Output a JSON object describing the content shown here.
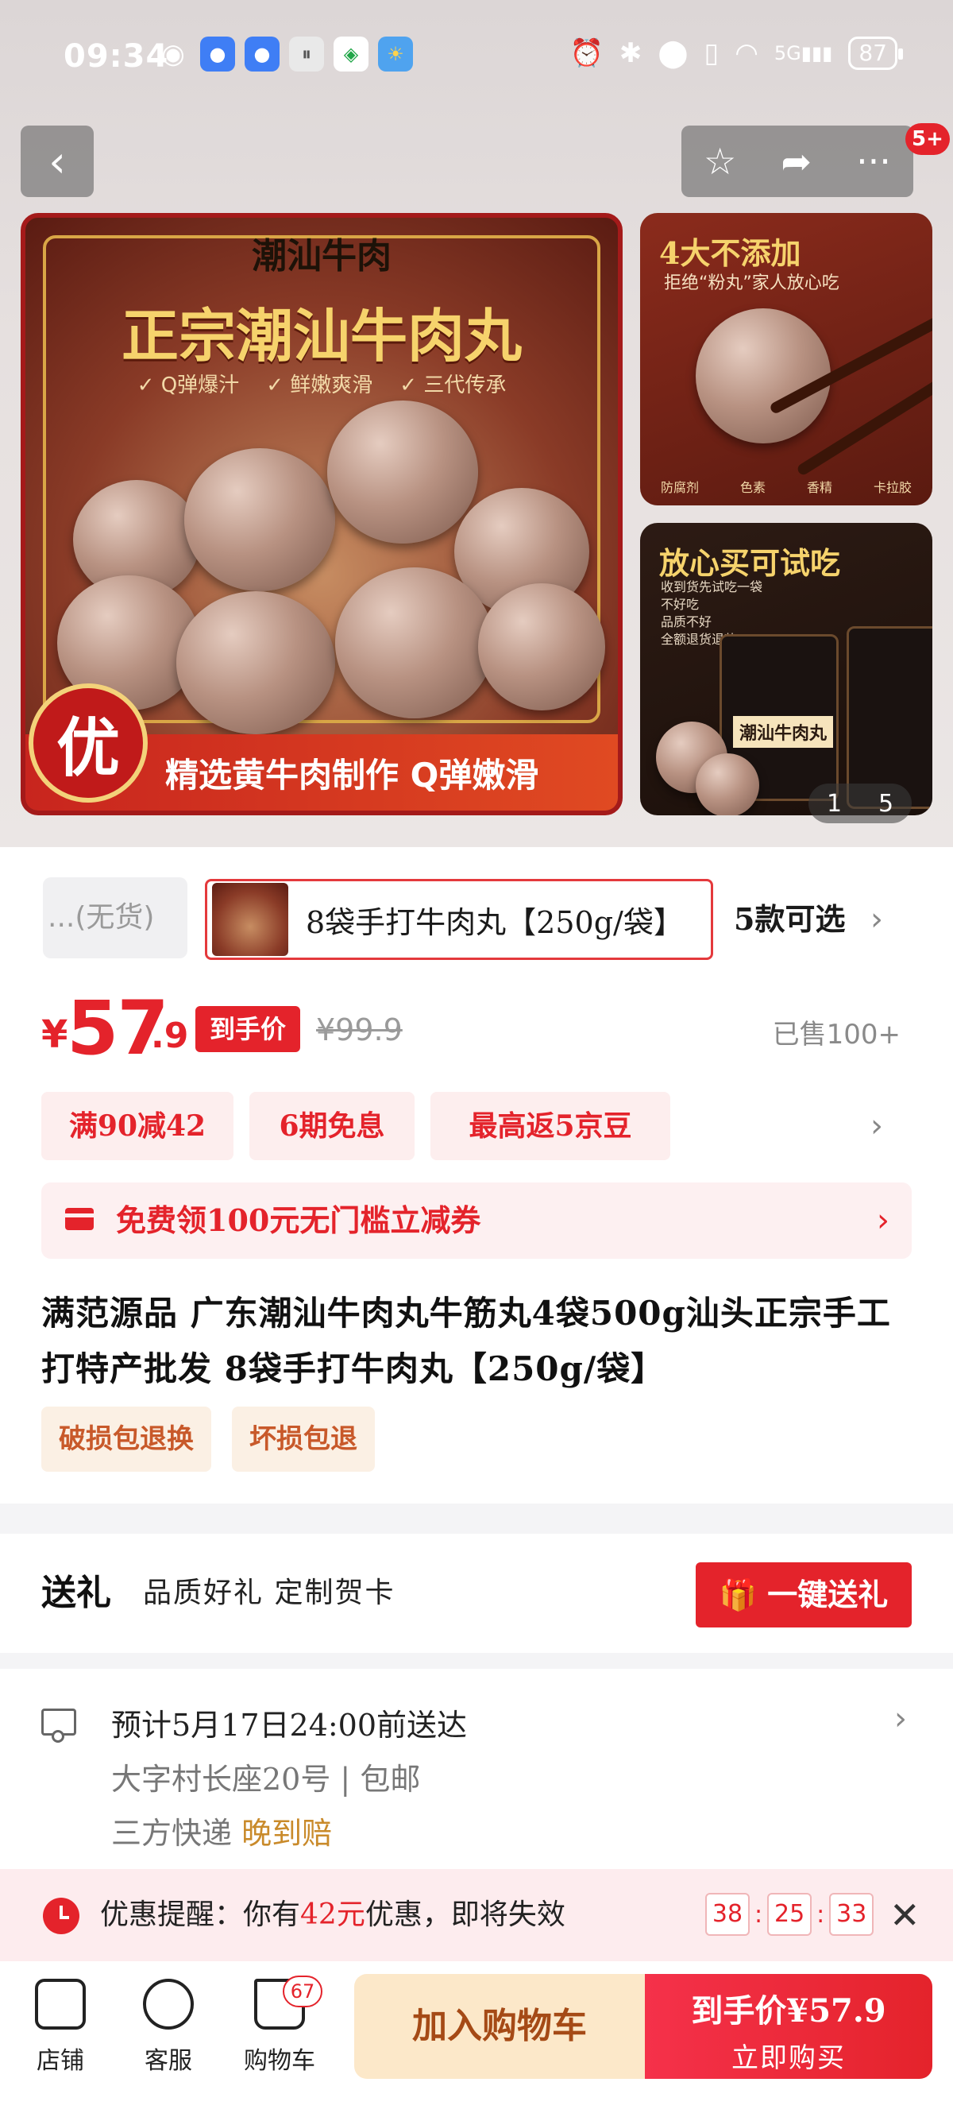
{
  "status_bar": {
    "time": "09:34",
    "network": "5G",
    "battery": "87",
    "app_icons": [
      "eye-icon",
      "chat-icon",
      "message-icon",
      "pay-icon",
      "carrier-icon",
      "weather-icon"
    ],
    "system_icons": [
      "alarm-icon",
      "bluetooth-icon",
      "location-icon",
      "vibrate-icon",
      "wifi-icon",
      "signal-icon"
    ]
  },
  "nav": {
    "back_glyph": "‹",
    "star_glyph": "☆",
    "share_glyph": "➦",
    "more_glyph": "···",
    "badge": "5+"
  },
  "gallery": {
    "main": {
      "top_tag": "潮汕牛肉",
      "headline": "正宗潮汕牛肉丸",
      "features": [
        "Q弹爆汁",
        "鲜嫩爽滑",
        "三代传承"
      ],
      "badge": "优",
      "banner": "精选黄牛肉制作 Q弹嫩滑"
    },
    "side_1": {
      "title": "4大不添加",
      "subtitle": "拒绝“粉丸”家人放心吃",
      "icons": [
        "防腐剂",
        "色素",
        "香精",
        "卡拉胶"
      ]
    },
    "side_2": {
      "title": "放心买可试吃",
      "note_lines": [
        "收到货先试吃一袋",
        "不好吃",
        "品质不好",
        "全额退货退款"
      ],
      "package_label": "潮汕牛肉丸"
    },
    "pager": {
      "current": "1",
      "total": "5"
    }
  },
  "variants": {
    "prev_label": "...(无货)",
    "current_label": "8袋手打牛肉丸【250g/袋】",
    "count_label": "5款可选",
    "chevron": "›"
  },
  "price": {
    "currency": "¥",
    "integer": "57",
    "decimal": ".9",
    "tag": "到手价",
    "original": "¥99.9",
    "sold": "已售100+"
  },
  "promos": {
    "chips": [
      "满90减42",
      "6期免息",
      "最高返5京豆"
    ],
    "chevron": "›"
  },
  "coupon": {
    "text": "免费领100元无门槛立减券",
    "chevron": "›"
  },
  "product": {
    "title": "满范源品 广东潮汕牛肉丸牛筋丸4袋500g汕头正宗手工打特产批发 8袋手打牛肉丸【250g/袋】",
    "services": [
      "破损包退换",
      "坏损包退"
    ]
  },
  "gift": {
    "title": "送礼",
    "subtitle": "品质好礼 定制贺卡",
    "button": "一键送礼",
    "button_icon": "gift-icon"
  },
  "shipping": {
    "eta": "预计5月17日24:00前送达",
    "address": "大字村长座20号 | 包邮",
    "carrier": "三方快递",
    "late_comp": "晚到赔",
    "chevron": "›"
  },
  "reminder": {
    "prefix": "优惠提醒：你有",
    "amount": "42元",
    "suffix": "优惠，即将失效",
    "hours": "38",
    "minutes": "25",
    "seconds": "33",
    "separator": ":",
    "close": "✕"
  },
  "bottom_bar": {
    "shop": "店铺",
    "service": "客服",
    "cart": "购物车",
    "cart_badge": "67",
    "add_to_cart": "加入购物车",
    "buy_top": "到手价¥57.9",
    "buy_bottom": "立即购买"
  },
  "colors": {
    "accent_red": "#e4232b",
    "coupon_bg": "#fdf0f1",
    "service_orange": "#c8592a",
    "cart_button_bg": "#fce8c9"
  }
}
